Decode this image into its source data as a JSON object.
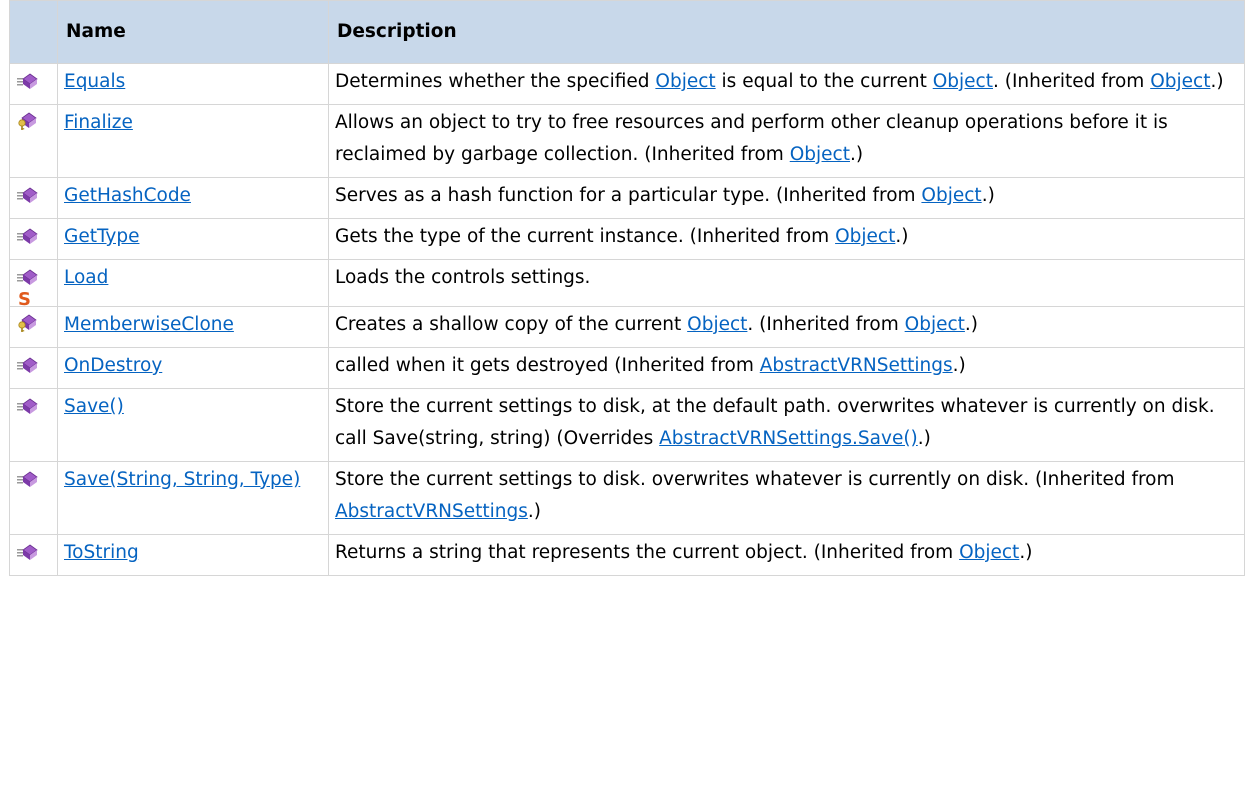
{
  "header": {
    "name_label": "Name",
    "description_label": "Description"
  },
  "rows": [
    {
      "icon": "public-method-icon",
      "name": "Equals",
      "desc": [
        {
          "t": "Determines whether the specified "
        },
        {
          "link": "Object"
        },
        {
          "t": " is equal to the current "
        },
        {
          "link": "Object"
        },
        {
          "t": ". (Inherited from "
        },
        {
          "link": "Object"
        },
        {
          "t": ".)"
        }
      ]
    },
    {
      "icon": "protected-method-icon",
      "name": "Finalize",
      "desc": [
        {
          "t": "Allows an object to try to free resources and perform other cleanup operations before it is reclaimed by garbage collection. (Inherited from "
        },
        {
          "link": "Object"
        },
        {
          "t": ".)"
        }
      ]
    },
    {
      "icon": "public-method-icon",
      "name": "GetHashCode",
      "desc": [
        {
          "t": "Serves as a hash function for a particular type. (Inherited from "
        },
        {
          "link": "Object"
        },
        {
          "t": ".)"
        }
      ]
    },
    {
      "icon": "public-method-icon",
      "name": "GetType",
      "desc": [
        {
          "t": "Gets the type of the current instance. (Inherited from "
        },
        {
          "link": "Object"
        },
        {
          "t": ".)"
        }
      ]
    },
    {
      "icon": "public-method-icon",
      "static": true,
      "static_label": "S",
      "name": "Load",
      "desc": [
        {
          "t": "Loads the controls settings."
        }
      ]
    },
    {
      "icon": "protected-method-icon",
      "name": "MemberwiseClone",
      "desc": [
        {
          "t": "Creates a shallow copy of the current "
        },
        {
          "link": "Object"
        },
        {
          "t": ". (Inherited from "
        },
        {
          "link": "Object"
        },
        {
          "t": ".)"
        }
      ]
    },
    {
      "icon": "public-method-icon",
      "name": "OnDestroy",
      "desc": [
        {
          "t": "called when it gets destroyed (Inherited from "
        },
        {
          "link": "AbstractVRNSettings"
        },
        {
          "t": ".)"
        }
      ]
    },
    {
      "icon": "public-method-icon",
      "name": "Save()",
      "desc": [
        {
          "t": "Store the current settings to disk, at the default path. overwrites whatever is currently on disk. call Save(string, string) (Overrides "
        },
        {
          "link": "AbstractVRNSettings.Save()"
        },
        {
          "t": ".)"
        }
      ]
    },
    {
      "icon": "public-method-icon",
      "name": "Save(String, String, Type)",
      "desc": [
        {
          "t": "Store the current settings to disk. overwrites whatever is currently on disk. (Inherited from "
        },
        {
          "link": "AbstractVRNSettings"
        },
        {
          "t": ".)"
        }
      ]
    },
    {
      "icon": "public-method-icon",
      "name": "ToString",
      "desc": [
        {
          "t": "Returns a string that represents the current object. (Inherited from "
        },
        {
          "link": "Object"
        },
        {
          "t": ".)"
        }
      ]
    }
  ],
  "colors": {
    "header_bg": "#c8d8ea",
    "link": "#0563c1",
    "border": "#d6d6d6",
    "method_icon_purple": "#a05cc8",
    "static_badge": "#e05a1c"
  }
}
